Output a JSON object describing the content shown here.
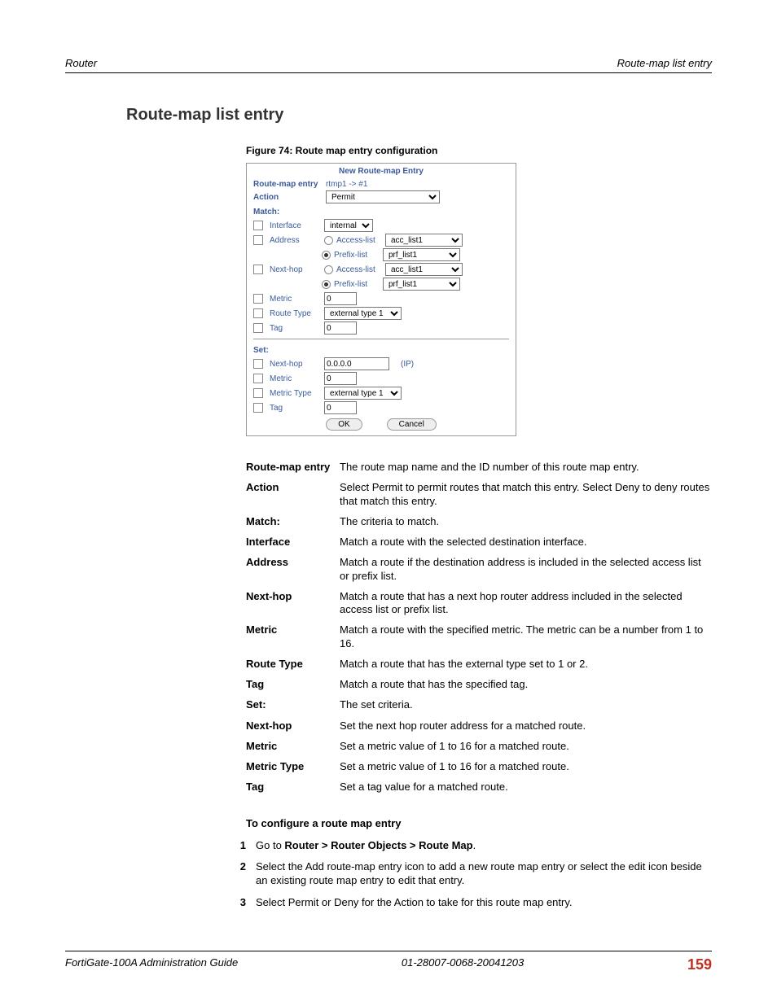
{
  "header": {
    "left": "Router",
    "right": "Route-map list entry"
  },
  "section_title": "Route-map list entry",
  "figure_label": "Figure 74: Route map entry configuration",
  "dialog": {
    "title": "New Route-map Entry",
    "entry_label": "Route-map entry",
    "entry_value": "rtmp1 -> #1",
    "action_label": "Action",
    "action_value": "Permit",
    "match_header": "Match:",
    "interface_label": "Interface",
    "interface_value": "internal",
    "address_label": "Address",
    "accesslist_label": "Access-list",
    "prefixlist_label": "Prefix-list",
    "acc_value": "acc_list1",
    "prf_value": "prf_list1",
    "nexthop_label": "Next-hop",
    "metric_label": "Metric",
    "metric_value": "0",
    "routetype_label": "Route Type",
    "routetype_value": "external type 1",
    "tag_label": "Tag",
    "tag_value": "0",
    "set_header": "Set:",
    "set_nexthop_value": "0.0.0.0",
    "set_nexthop_hint": "(IP)",
    "set_metric_value": "0",
    "metrictype_label": "Metric Type",
    "set_metrictype_value": "external type 1",
    "set_tag_value": "0",
    "ok": "OK",
    "cancel": "Cancel"
  },
  "defs": [
    {
      "term": "Route-map entry",
      "desc": "The route map name and the ID number of this route map entry."
    },
    {
      "term": "Action",
      "desc": "Select Permit to permit routes that match this entry. Select Deny to deny routes that match this entry."
    },
    {
      "term": "Match:",
      "desc": "The criteria to match."
    },
    {
      "term": "Interface",
      "desc": "Match a route with the selected destination interface."
    },
    {
      "term": "Address",
      "desc": "Match a route if the destination address is included in the selected access list or prefix list."
    },
    {
      "term": "Next-hop",
      "desc": "Match a route that has a next hop router address included in the selected access list or prefix list."
    },
    {
      "term": "Metric",
      "desc": "Match a route with the specified metric. The metric can be a number from 1 to 16."
    },
    {
      "term": "Route Type",
      "desc": "Match a route that has the external type set to 1 or 2."
    },
    {
      "term": "Tag",
      "desc": "Match a route that has the specified tag."
    },
    {
      "term": "Set:",
      "desc": "The set criteria."
    },
    {
      "term": "Next-hop",
      "desc": "Set the next hop router address for a matched route."
    },
    {
      "term": "Metric",
      "desc": "Set a metric value of 1 to 16 for a matched route."
    },
    {
      "term": "Metric Type",
      "desc": "Set a metric value of 1 to 16 for a matched route."
    },
    {
      "term": "Tag",
      "desc": "Set a tag value for a matched route."
    }
  ],
  "proc_head": "To configure a route map entry",
  "steps": [
    {
      "n": "1",
      "pre": "Go to ",
      "bold": "Router > Router Objects > Route Map",
      "post": "."
    },
    {
      "n": "2",
      "pre": "Select the Add route-map entry icon to add a new route map entry or select the edit icon beside an existing route map entry to edit that entry.",
      "bold": "",
      "post": ""
    },
    {
      "n": "3",
      "pre": "Select Permit or Deny for the Action to take for this route map entry.",
      "bold": "",
      "post": ""
    }
  ],
  "footer": {
    "left": "FortiGate-100A Administration Guide",
    "center": "01-28007-0068-20041203",
    "page": "159"
  }
}
